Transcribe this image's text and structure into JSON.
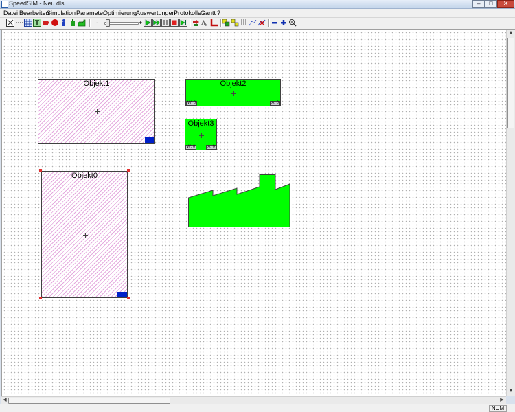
{
  "window": {
    "title": "SpeedSIM - Neu.dls",
    "controls": [
      "–",
      "□",
      "✕"
    ]
  },
  "menu": [
    "Datei",
    "Bearbeiten",
    "Simulation",
    "Parameter",
    "Optimierung",
    "Auswertungen",
    "Protokolle",
    "Gantt",
    "?"
  ],
  "toolbar": {
    "slider_minus": "-",
    "slider_plus": "+",
    "speed_level": 0.05
  },
  "canvas": {
    "objects": [
      {
        "name": "Objekt1",
        "type": "hatched"
      },
      {
        "name": "Objekt2",
        "type": "green",
        "port_left": "W: 0",
        "port_right": "A: 0"
      },
      {
        "name": "Objekt3",
        "type": "green",
        "port_left": "W: 0",
        "port_right": "A: 0"
      },
      {
        "name": "Objekt0",
        "type": "hatched",
        "selected": true
      }
    ],
    "factory_icon": "factory-icon"
  },
  "colors": {
    "hatch": "#e4a8de",
    "green": "#00ff00",
    "blue_tab": "#0020c8",
    "selection": "#e03030"
  },
  "status": {
    "num": "NUM"
  }
}
